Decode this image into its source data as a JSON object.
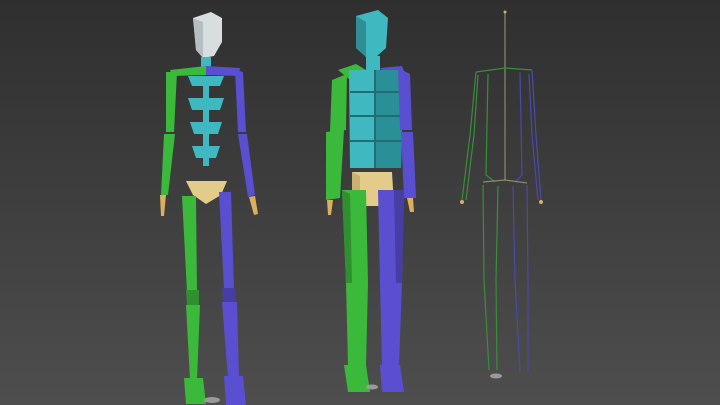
{
  "scene": {
    "background_top": "#2f2f2f",
    "background_bottom": "#4e4e4e",
    "figures": [
      {
        "name": "biped-skeleton",
        "style": "segmented-bones"
      },
      {
        "name": "blocky-mannequin",
        "style": "box-mesh"
      },
      {
        "name": "wireframe-rig",
        "style": "line-rig"
      }
    ],
    "colors": {
      "right_side": "#3bb93b",
      "left_side": "#5a4fd0",
      "spine": "#3fb8c0",
      "head": "#d8dde0",
      "pelvis": "#e3cc8a",
      "rig_line": "#3a8e3a",
      "rig_line_alt": "#4a4aa8",
      "rig_spine": "#8a8a6a",
      "joint_tip": "#d9b060"
    }
  }
}
